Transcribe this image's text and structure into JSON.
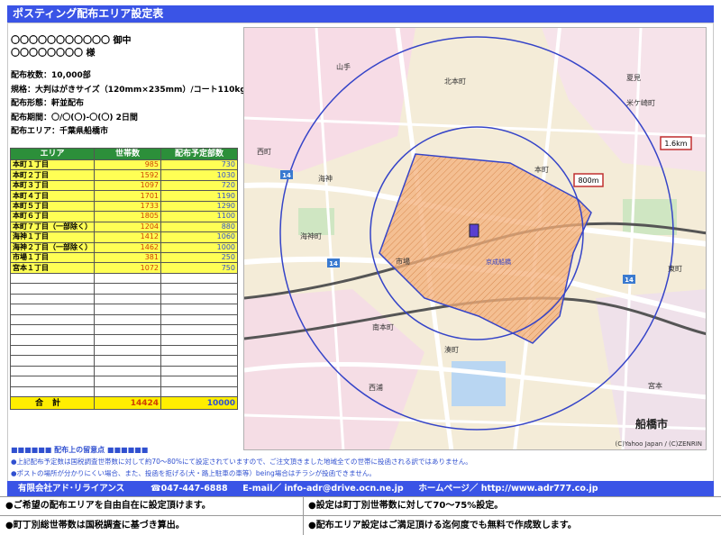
{
  "title": "ポスティング配布エリア設定表",
  "client": {
    "line1": "〇〇〇〇〇〇〇〇〇〇〇 御中",
    "line2": "〇〇〇〇〇〇〇〇 様"
  },
  "info": {
    "count": "配布枚数：10,000部",
    "spec": "規格：大判はがきサイズ（120mm×235mm）/コート110kg",
    "form": "配布形態：軒並配布",
    "period": "配布期間：〇/〇(〇)-〇(〇) 2日間",
    "area": "配布エリア：千葉県船橋市"
  },
  "table": {
    "headers": [
      "エリア",
      "世帯数",
      "配布予定部数"
    ],
    "rows": [
      {
        "name": "本町１丁目",
        "households": "985",
        "planned": "730"
      },
      {
        "name": "本町２丁目",
        "households": "1592",
        "planned": "1030"
      },
      {
        "name": "本町３丁目",
        "households": "1097",
        "planned": "720"
      },
      {
        "name": "本町４丁目",
        "households": "1701",
        "planned": "1190"
      },
      {
        "name": "本町５丁目",
        "households": "1733",
        "planned": "1290"
      },
      {
        "name": "本町６丁目",
        "households": "1805",
        "planned": "1100"
      },
      {
        "name": "本町７丁目（一部除く）",
        "households": "1204",
        "planned": "880"
      },
      {
        "name": "海神１丁目",
        "households": "1412",
        "planned": "1060"
      },
      {
        "name": "海神２丁目（一部除く）",
        "households": "1462",
        "planned": "1000"
      },
      {
        "name": "市場１丁目",
        "households": "381",
        "planned": "250"
      },
      {
        "name": "宮本１丁目",
        "households": "1072",
        "planned": "750"
      }
    ],
    "total_label": "合計",
    "total_households": "14424",
    "total_planned": "10000"
  },
  "map": {
    "labels": {
      "yamate": "山手",
      "kitahoncho": "北本町",
      "natsumi": "夏見",
      "komegasaki": "米ケ崎町",
      "nishimachi": "西町",
      "kaijin": "海神",
      "kaijinshin": "海神町",
      "honcho": "本町",
      "ichiba": "市場",
      "minamihoncho": "南本町",
      "hamacho": "湊町",
      "miyamoto": "宮本",
      "higashi": "東町",
      "funabashi": "船橋市",
      "nishiura": "西浦",
      "kyodo": "京成船橋",
      "r14a": "14",
      "r14b": "14",
      "r14c": "14"
    },
    "radius_outer": "1.6km",
    "radius_inner": "800m",
    "copyright": "(C)Yahoo Japan / (C)ZENRIN",
    "colors": {
      "circle": "#3544c8",
      "area_fill": "#f0a060",
      "road_major": "#ffffff",
      "rail": "#555555"
    }
  },
  "notes": {
    "title": "■■■■■■  配布上の留意点  ■■■■■■",
    "note1": "●上記配布予定数は国税調査世帯数に対して約70～80%にて設定されていますので、ご注文頂きました地域全ての世帯に投函される訳ではありません。",
    "note2": "●ポストの場所が分かりにくい場合、また、投函を拒げる(犬・路上駐車の車等）being場合はチラシが投函できません。"
  },
  "footer": {
    "company": "有限会社アド･リライアンス",
    "phone": "☎047-447-6888",
    "email": "E-mail／ info-adr@drive.ocn.ne.jp",
    "web": "ホームページ／ http://www.adr777.co.jp"
  },
  "bullets": {
    "b1": "●ご希望の配布エリアを自由自在に設定頂けます。",
    "b2": "●設定は町丁別世帯数に対して70～75%設定。",
    "b3": "●町丁別総世帯数は国税調査に基づき算出。",
    "b4": "●配布エリア設定はご満足頂ける迄何度でも無料で作成致します。"
  }
}
